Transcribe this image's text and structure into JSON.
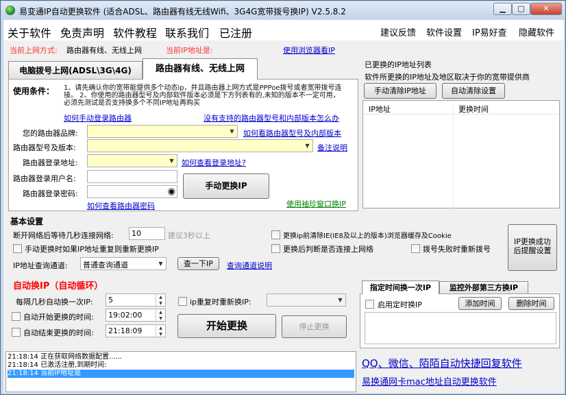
{
  "window": {
    "title": "易变通IP自动更换软件 (适合ADSL、路由器有线无线Wifi、3G4G宽带拨号换IP) V2.5.8.2",
    "minimize": "▁",
    "maximize": "□",
    "close": "✕"
  },
  "menu": {
    "left": [
      "关于软件",
      "免责声明",
      "软件教程",
      "联系我们",
      "已注册"
    ],
    "right": [
      "建议反馈",
      "软件设置",
      "IP易好查",
      "隐藏软件"
    ]
  },
  "status": {
    "net_label": "当前上网方式:",
    "net_value": "路由器有线、无线上网",
    "ip_label": "当前IP地址是:",
    "ip_link": "使用浏览器看IP"
  },
  "tabs": [
    "电脑拨号上网(ADSL\\3G\\4G)",
    "路由器有线、无线上网"
  ],
  "conditions": {
    "label": "使用条件：",
    "text": "1、请先确认你的宽带能提供多个动态ip，并且路由器上网方式是PPPoe拨号或者宽带拨号连接。  2、你使用的路由器型号及内部软件版本必须是下方列表有的,未知的版本不一定可用，必须先测试是否支持换多个不同IP地址再购买",
    "link_manual": "如何手动登录路由器",
    "link_unsupported": "没有支持的路由器型号和内部版本怎么办"
  },
  "router": {
    "brand_label": "您的路由器品牌:",
    "brand_link": "如何看路由器型号及内部版本",
    "model_label": "路由器型号及版本:",
    "model_link": "备注说明",
    "addr_label": "路由器登录地址:",
    "addr_link": "如何查看登录地址?",
    "user_label": "路由器登录用户名:",
    "pass_label": "路由器登录密码:",
    "pass_link": "如何查看路由器密码",
    "manual_button": "手动更换IP",
    "small_window_link": "使用袖珍窗口换IP"
  },
  "history": {
    "title": "已更换的IP地址列表",
    "note": "软件所更换的IP地址及地区取决于你的宽带提供商",
    "clear_manual": "手动清除IP地址",
    "clear_auto": "自动清除设置",
    "col_ip": "IP地址",
    "col_time": "更换时间"
  },
  "basic": {
    "title": "基本设置",
    "reconnect_label": "断开网络后等待几秒连接网络:",
    "reconnect_value": "10",
    "reconnect_hint": "建议3秒以上",
    "clear_ie": "更换ip前清除IE(IE8及以上的版本)浏览器缓存及Cookie",
    "repeat_change": "手动更换时如果IP地址重复则重新更换IP",
    "check_net": "更换后判断是否连接上网络",
    "redial": "拨号失败时重新拨号",
    "query_label": "IP地址查询通道:",
    "query_value": "普通查询通道",
    "query_button": "查一下IP",
    "query_link": "查询通道说明",
    "remind_button": "IP更换成功后提醒设置"
  },
  "auto": {
    "title": "自动换IP（自动循环）",
    "interval_label": "每隔几秒自动换一次IP:",
    "interval_value": "5",
    "repeat_label": "ip重复时重新换IP:",
    "start_label": "自动开始更换的时间:",
    "start_value": "19:02:00",
    "end_label": "自动结束更换的时间:",
    "end_value": "21:18:09",
    "start_button": "开始更换",
    "stop_button": "停止更换"
  },
  "schedule": {
    "tab1": "指定时间换一次IP",
    "tab2": "监控外部第三方换IP",
    "enable": "启用定时换IP",
    "add": "添加时间",
    "delete": "删除时间"
  },
  "log": [
    {
      "text": "21:18:14 正在获取网络数据配置......",
      "selected": false
    },
    {
      "text": "21:18:14 已激活注册,到期时间:",
      "selected": false
    },
    {
      "text": "21:18:14 当前IP地址是",
      "selected": true
    }
  ],
  "ads": [
    "QQ、微信、陌陌自动快捷回复软件",
    "易换通网卡mac地址自动更换软件"
  ],
  "colors": {
    "link": "#0000cc",
    "red": "#ff3333",
    "green": "#008000",
    "log_selected": "#3399ff"
  }
}
